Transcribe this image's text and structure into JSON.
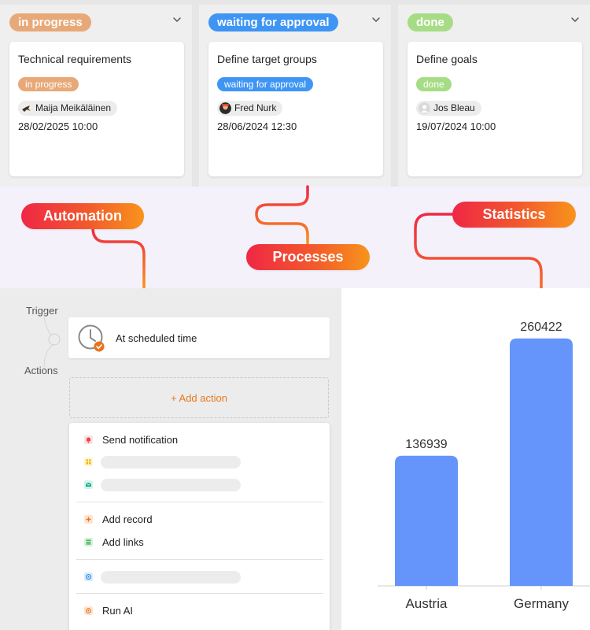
{
  "kanban": {
    "columns": [
      {
        "status": "in progress",
        "color": "#e8a978",
        "card": {
          "title": "Technical requirements",
          "badge": "in progress",
          "person": "Maija Meikäläinen",
          "date": "28/02/2025 10:00"
        }
      },
      {
        "status": "waiting for approval",
        "color": "#3e95f4",
        "card": {
          "title": "Define target groups",
          "badge": "waiting for approval",
          "person": "Fred Nurk",
          "date": "28/06/2024 12:30"
        }
      },
      {
        "status": "done",
        "color": "#a7dc86",
        "card": {
          "title": "Define goals",
          "badge": "done",
          "person": "Jos Bleau",
          "date": "19/07/2024 10:00"
        }
      }
    ]
  },
  "labels": {
    "automation": "Automation",
    "processes": "Processes",
    "statistics": "Statistics"
  },
  "automation": {
    "trigger_label": "Trigger",
    "actions_label": "Actions",
    "trigger_text": "At scheduled time",
    "add_action": "+ Add action",
    "menu": {
      "send_notification": "Send notification",
      "add_record": "Add record",
      "add_links": "Add links",
      "run_ai": "Run AI"
    }
  },
  "colors": {
    "accent_gradient_start": "#ef2745",
    "accent_gradient_end": "#f8941b",
    "bar": "#6595fb"
  },
  "chart_data": {
    "type": "bar",
    "categories": [
      "Austria",
      "Germany"
    ],
    "values": [
      136939,
      260422
    ],
    "title": "",
    "xlabel": "",
    "ylabel": "",
    "ylim": [
      0,
      300000
    ],
    "grid": false,
    "data_labels": true
  }
}
